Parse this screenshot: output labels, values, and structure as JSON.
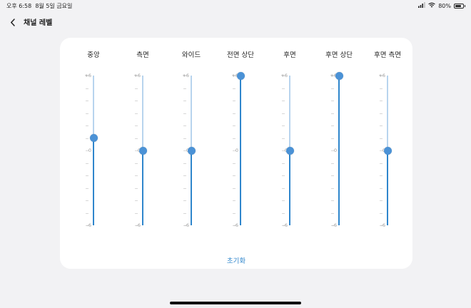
{
  "status": {
    "time": "오후 6:58",
    "date": "8월 5일 금요일",
    "battery_text": "80%",
    "battery_level": 0.8,
    "wifi_icon": "wifi-icon",
    "signal_icon": "signal-icon"
  },
  "header": {
    "back_icon": "chevron-left-icon",
    "title": "채널 레벨"
  },
  "scale": {
    "max_label": "+6",
    "mid_label": "0",
    "min_label": "-6",
    "min": -6,
    "max": 6
  },
  "channels": [
    {
      "label": "중앙",
      "value": 1
    },
    {
      "label": "측면",
      "value": 0
    },
    {
      "label": "와이드",
      "value": 0
    },
    {
      "label": "전면 상단",
      "value": 6
    },
    {
      "label": "후면",
      "value": 0
    },
    {
      "label": "후면 상단",
      "value": 6
    },
    {
      "label": "후면 측면",
      "value": 0
    }
  ],
  "reset_label": "초기화",
  "colors": {
    "accent": "#2f86cc",
    "thumb": "#4b92d6",
    "track_inactive": "#b8d4ee",
    "background": "#f2f2f4",
    "card": "#ffffff"
  }
}
